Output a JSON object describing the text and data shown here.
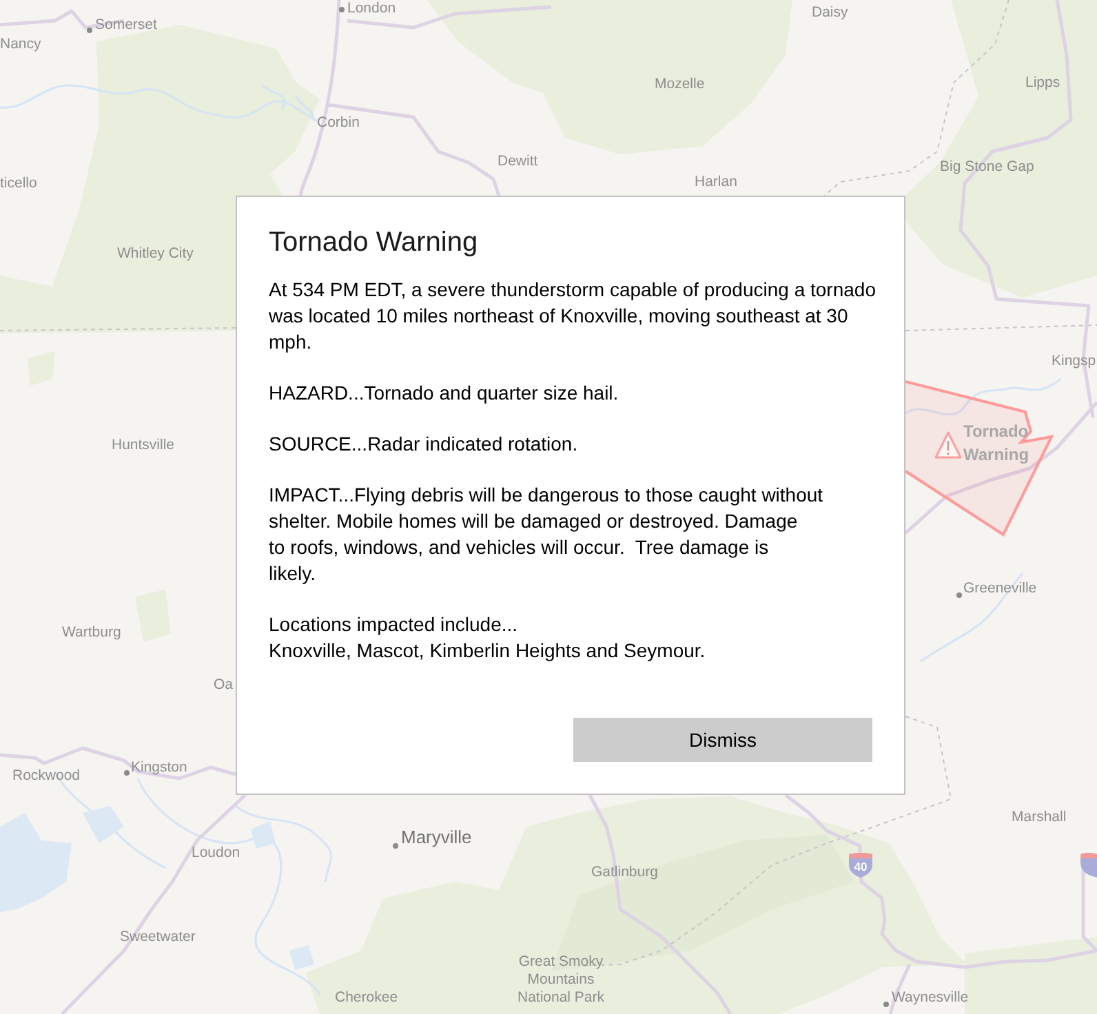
{
  "map": {
    "places": [
      {
        "label": "London",
        "kind": "town"
      },
      {
        "label": "Daisy",
        "kind": "place"
      },
      {
        "label": "Somerset",
        "kind": "town"
      },
      {
        "label": "Nancy",
        "kind": "place"
      },
      {
        "label": "Lipps",
        "kind": "place"
      },
      {
        "label": "Mozelle",
        "kind": "place"
      },
      {
        "label": "Corbin",
        "kind": "place"
      },
      {
        "label": "Dewitt",
        "kind": "place"
      },
      {
        "label": "Big Stone Gap",
        "kind": "place"
      },
      {
        "label": "Harlan",
        "kind": "place"
      },
      {
        "label": "ticello",
        "kind": "place"
      },
      {
        "label": "Whitley City",
        "kind": "place"
      },
      {
        "label": "Kingsp",
        "kind": "place"
      },
      {
        "label": "Huntsville",
        "kind": "place"
      },
      {
        "label": "Greeneville",
        "kind": "town"
      },
      {
        "label": "Wartburg",
        "kind": "place"
      },
      {
        "label": "Oa",
        "kind": "place"
      },
      {
        "label": "Kingston",
        "kind": "town"
      },
      {
        "label": "Rockwood",
        "kind": "place"
      },
      {
        "label": "Marshall",
        "kind": "place"
      },
      {
        "label": "Maryville",
        "kind": "city"
      },
      {
        "label": "Loudon",
        "kind": "place"
      },
      {
        "label": "Gatlinburg",
        "kind": "place"
      },
      {
        "label": "Sweetwater",
        "kind": "place"
      },
      {
        "label": "Cherokee",
        "kind": "place"
      },
      {
        "label": "Great Smoky\nMountains\nNational Park",
        "kind": "park"
      },
      {
        "label": "Waynesville",
        "kind": "town"
      }
    ],
    "highway_shields": [
      {
        "number": "40"
      }
    ],
    "warning_area": {
      "label": "Tornado Warning"
    }
  },
  "dialog": {
    "title": "Tornado Warning",
    "paragraphs": [
      "At 534 PM EDT, a severe thunderstorm capable of producing a tornado\nwas located 10 miles northeast of Knoxville, moving southeast at 30\nmph.",
      "HAZARD...Tornado and quarter size hail.",
      "SOURCE...Radar indicated rotation.",
      "IMPACT...Flying debris will be dangerous to those caught without\nshelter. Mobile homes will be damaged or destroyed. Damage\nto roofs, windows, and vehicles will occur.  Tree damage is\nlikely.",
      "Locations impacted include...\nKnoxville, Mascot, Kimberlin Heights and Seymour."
    ],
    "button": {
      "label": "Dismiss"
    }
  }
}
